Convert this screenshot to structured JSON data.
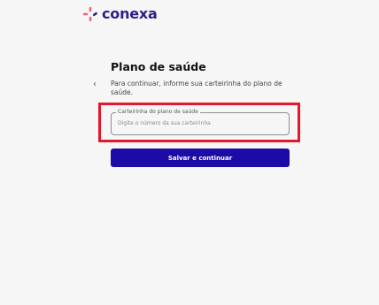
{
  "brand": {
    "name": "conexa",
    "logo_icon": "conexa-logo-icon",
    "primary_color": "#1c0ba7",
    "accent_color": "#f0607a"
  },
  "page": {
    "back_icon": "chevron-left-icon",
    "title": "Plano de saúde",
    "subtitle": "Para continuar, informe sua carteirinha do plano de saúde."
  },
  "form": {
    "card_field": {
      "label": "Carteirinha do plano de saúde",
      "placeholder": "Digite o número da sua carteirinha",
      "value": ""
    },
    "submit_label": "Salvar e continuar"
  }
}
